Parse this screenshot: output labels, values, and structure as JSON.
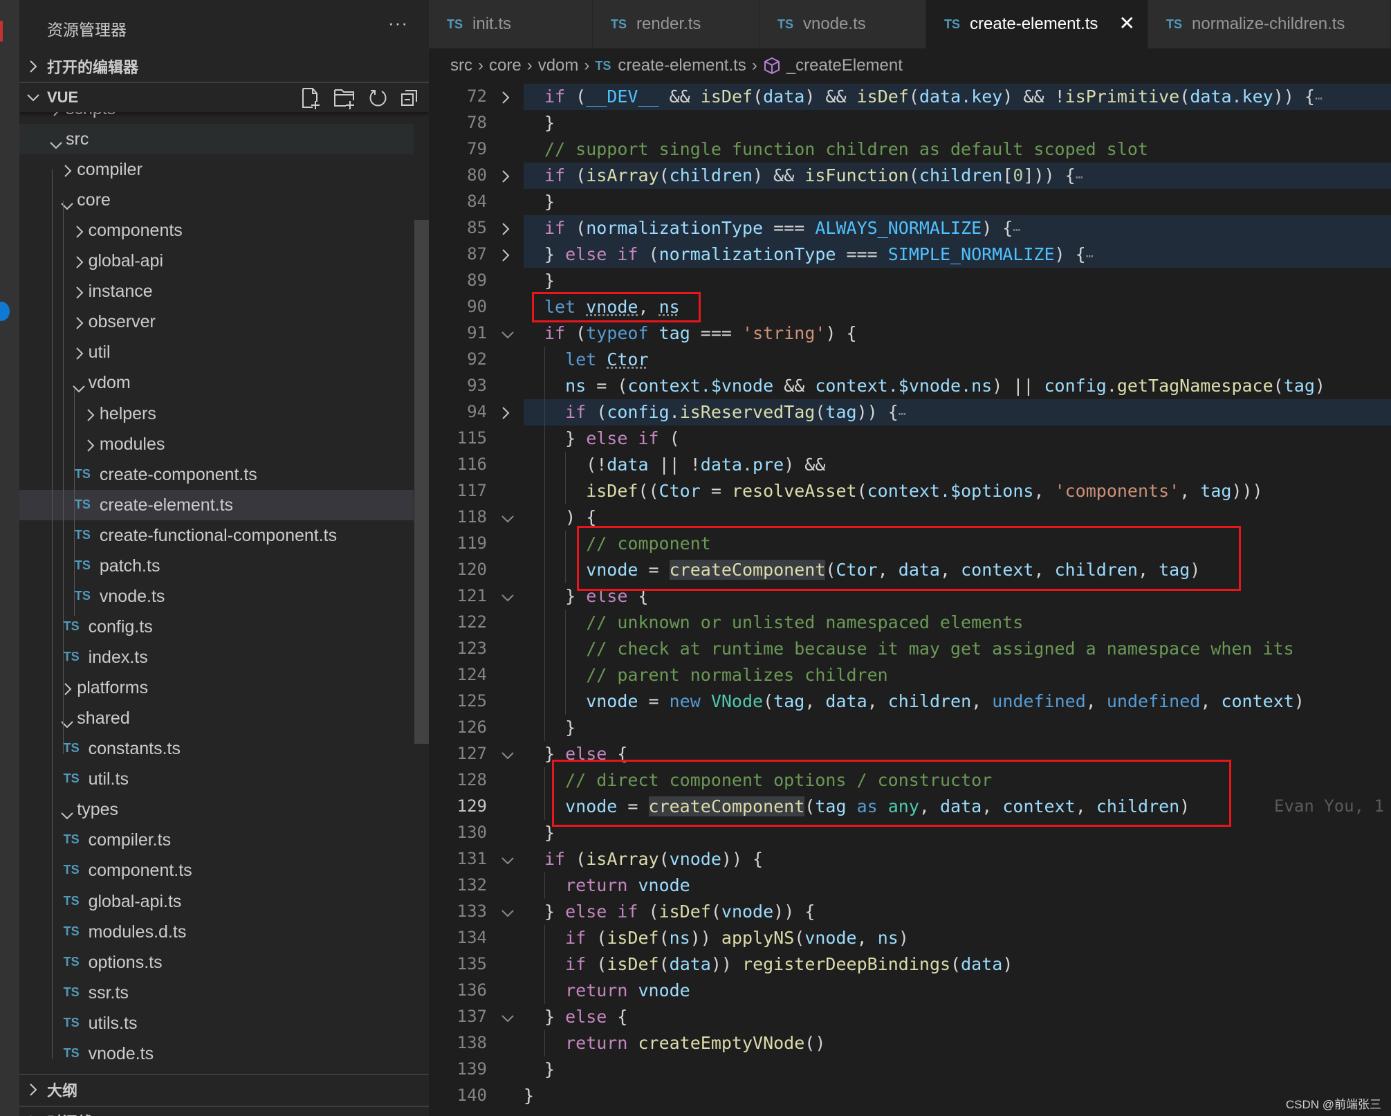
{
  "sidebar": {
    "title": "资源管理器",
    "more": "···",
    "open_editors": "打开的编辑器",
    "workspace": "VUE",
    "outline": "大纲",
    "timeline": "时间线",
    "actions": [
      "new-file-icon",
      "new-folder-icon",
      "refresh-icon",
      "collapse-all-icon"
    ],
    "tree": [
      {
        "label": "scripts",
        "level": 0,
        "type": "folder",
        "open": false
      },
      {
        "label": "src",
        "level": 0,
        "type": "folder",
        "open": true,
        "state": "hover"
      },
      {
        "label": "compiler",
        "level": 1,
        "type": "folder",
        "open": false
      },
      {
        "label": "core",
        "level": 1,
        "type": "folder",
        "open": true
      },
      {
        "label": "components",
        "level": 2,
        "type": "folder",
        "open": false
      },
      {
        "label": "global-api",
        "level": 2,
        "type": "folder",
        "open": false
      },
      {
        "label": "instance",
        "level": 2,
        "type": "folder",
        "open": false
      },
      {
        "label": "observer",
        "level": 2,
        "type": "folder",
        "open": false
      },
      {
        "label": "util",
        "level": 2,
        "type": "folder",
        "open": false
      },
      {
        "label": "vdom",
        "level": 2,
        "type": "folder",
        "open": true
      },
      {
        "label": "helpers",
        "level": 3,
        "type": "folder",
        "open": false
      },
      {
        "label": "modules",
        "level": 3,
        "type": "folder",
        "open": false
      },
      {
        "label": "create-component.ts",
        "level": 3,
        "type": "ts"
      },
      {
        "label": "create-element.ts",
        "level": 3,
        "type": "ts",
        "state": "selected"
      },
      {
        "label": "create-functional-component.ts",
        "level": 3,
        "type": "ts"
      },
      {
        "label": "patch.ts",
        "level": 3,
        "type": "ts"
      },
      {
        "label": "vnode.ts",
        "level": 3,
        "type": "ts"
      },
      {
        "label": "config.ts",
        "level": 2,
        "type": "ts"
      },
      {
        "label": "index.ts",
        "level": 2,
        "type": "ts"
      },
      {
        "label": "platforms",
        "level": 1,
        "type": "folder",
        "open": false
      },
      {
        "label": "shared",
        "level": 1,
        "type": "folder",
        "open": true
      },
      {
        "label": "constants.ts",
        "level": 2,
        "type": "ts"
      },
      {
        "label": "util.ts",
        "level": 2,
        "type": "ts"
      },
      {
        "label": "types",
        "level": 1,
        "type": "folder",
        "open": true
      },
      {
        "label": "compiler.ts",
        "level": 2,
        "type": "ts"
      },
      {
        "label": "component.ts",
        "level": 2,
        "type": "ts"
      },
      {
        "label": "global-api.ts",
        "level": 2,
        "type": "ts"
      },
      {
        "label": "modules.d.ts",
        "level": 2,
        "type": "ts"
      },
      {
        "label": "options.ts",
        "level": 2,
        "type": "ts"
      },
      {
        "label": "ssr.ts",
        "level": 2,
        "type": "ts"
      },
      {
        "label": "utils.ts",
        "level": 2,
        "type": "ts"
      },
      {
        "label": "vnode.ts",
        "level": 2,
        "type": "ts"
      }
    ]
  },
  "ts_badge": "TS",
  "tabs": [
    {
      "label": "init.ts",
      "active": false
    },
    {
      "label": "render.ts",
      "active": false
    },
    {
      "label": "vnode.ts",
      "active": false
    },
    {
      "label": "create-element.ts",
      "active": true
    },
    {
      "label": "normalize-children.ts",
      "active": false
    }
  ],
  "tab_close": "✕",
  "breadcrumb": {
    "parts": [
      "src",
      "core",
      "vdom"
    ],
    "file": "create-element.ts",
    "symbol": "_createElement",
    "separator": "›"
  },
  "blame": "Evan You, 1",
  "watermark": "CSDN @前端张三",
  "colors": {
    "accent": "#519aba",
    "highlight_box": "#e8161c",
    "background": "#1e1e1e",
    "sidebar": "#252526"
  },
  "code": [
    {
      "n": "72",
      "fold": "closed",
      "hl": true,
      "indent": 0,
      "tokens": [
        [
          "if",
          "k"
        ],
        [
          " (",
          "p"
        ],
        [
          "__DEV__",
          "C"
        ],
        [
          " && ",
          "p"
        ],
        [
          "isDef",
          "f"
        ],
        [
          "(",
          "p"
        ],
        [
          "data",
          "v"
        ],
        [
          ") && ",
          "p"
        ],
        [
          "isDef",
          "f"
        ],
        [
          "(",
          "p"
        ],
        [
          "data.key",
          "v"
        ],
        [
          ") && !",
          "p"
        ],
        [
          "isPrimitive",
          "f"
        ],
        [
          "(",
          "p"
        ],
        [
          "data.key",
          "v"
        ],
        [
          ")) {",
          "p"
        ],
        [
          "⋯",
          "e"
        ]
      ]
    },
    {
      "n": "78",
      "indent": 0,
      "tokens": [
        [
          "}",
          "p"
        ]
      ]
    },
    {
      "n": "79",
      "indent": 0,
      "tokens": [
        [
          "// support single function children as default scoped slot",
          "c"
        ]
      ]
    },
    {
      "n": "80",
      "fold": "closed",
      "hl": true,
      "indent": 0,
      "tokens": [
        [
          "if",
          "k"
        ],
        [
          " (",
          "p"
        ],
        [
          "isArray",
          "f"
        ],
        [
          "(",
          "p"
        ],
        [
          "children",
          "v"
        ],
        [
          ") && ",
          "p"
        ],
        [
          "isFunction",
          "f"
        ],
        [
          "(",
          "p"
        ],
        [
          "children",
          "v"
        ],
        [
          "[",
          "p"
        ],
        [
          "0",
          "n"
        ],
        [
          "])) {",
          "p"
        ],
        [
          "⋯",
          "e"
        ]
      ]
    },
    {
      "n": "84",
      "indent": 0,
      "tokens": [
        [
          "}",
          "p"
        ]
      ]
    },
    {
      "n": "85",
      "fold": "closed",
      "hl": true,
      "indent": 0,
      "tokens": [
        [
          "if",
          "k"
        ],
        [
          " (",
          "p"
        ],
        [
          "normalizationType",
          "v"
        ],
        [
          " === ",
          "p"
        ],
        [
          "ALWAYS_NORMALIZE",
          "C"
        ],
        [
          ") {",
          "p"
        ],
        [
          "⋯",
          "e"
        ]
      ]
    },
    {
      "n": "87",
      "fold": "closed",
      "hl": true,
      "indent": 0,
      "tokens": [
        [
          "} ",
          "p"
        ],
        [
          "else if",
          "k"
        ],
        [
          " (",
          "p"
        ],
        [
          "normalizationType",
          "v"
        ],
        [
          " === ",
          "p"
        ],
        [
          "SIMPLE_NORMALIZE",
          "C"
        ],
        [
          ") {",
          "p"
        ],
        [
          "⋯",
          "e"
        ]
      ]
    },
    {
      "n": "89",
      "indent": 0,
      "tokens": [
        [
          "}",
          "p"
        ]
      ]
    },
    {
      "n": "90",
      "indent": 0,
      "tokens": [
        [
          "let",
          "b"
        ],
        [
          " ",
          "p"
        ],
        [
          "vnode",
          "v dots"
        ],
        [
          ", ",
          "p"
        ],
        [
          "ns",
          "v dots"
        ]
      ]
    },
    {
      "n": "91",
      "fold": "open",
      "indent": 0,
      "tokens": [
        [
          "if",
          "k"
        ],
        [
          " (",
          "p"
        ],
        [
          "typeof",
          "b"
        ],
        [
          " ",
          "p"
        ],
        [
          "tag",
          "v"
        ],
        [
          " === ",
          "p"
        ],
        [
          "'string'",
          "s"
        ],
        [
          ") {",
          "p"
        ]
      ]
    },
    {
      "n": "92",
      "indent": 1,
      "tokens": [
        [
          "let",
          "b"
        ],
        [
          " ",
          "p"
        ],
        [
          "Ctor",
          "v dots"
        ]
      ]
    },
    {
      "n": "93",
      "indent": 1,
      "tokens": [
        [
          "ns",
          "v"
        ],
        [
          " = (",
          "p"
        ],
        [
          "context.$vnode",
          "v"
        ],
        [
          " && ",
          "p"
        ],
        [
          "context.$vnode.ns",
          "v"
        ],
        [
          ") || ",
          "p"
        ],
        [
          "config",
          "v"
        ],
        [
          ".",
          "p"
        ],
        [
          "getTagNamespace",
          "f"
        ],
        [
          "(",
          "p"
        ],
        [
          "tag",
          "v"
        ],
        [
          ")",
          "p"
        ]
      ]
    },
    {
      "n": "94",
      "fold": "closed",
      "hl": true,
      "indent": 1,
      "tokens": [
        [
          "if",
          "k"
        ],
        [
          " (",
          "p"
        ],
        [
          "config",
          "v"
        ],
        [
          ".",
          "p"
        ],
        [
          "isReservedTag",
          "f"
        ],
        [
          "(",
          "p"
        ],
        [
          "tag",
          "v"
        ],
        [
          ")) {",
          "p"
        ],
        [
          "⋯",
          "e"
        ]
      ]
    },
    {
      "n": "115",
      "indent": 1,
      "tokens": [
        [
          "} ",
          "p"
        ],
        [
          "else if",
          "k"
        ],
        [
          " (",
          "p"
        ]
      ]
    },
    {
      "n": "116",
      "indent": 2,
      "tokens": [
        [
          "(!",
          "p"
        ],
        [
          "data",
          "v"
        ],
        [
          " || !",
          "p"
        ],
        [
          "data.pre",
          "v"
        ],
        [
          ") &&",
          "p"
        ]
      ]
    },
    {
      "n": "117",
      "indent": 2,
      "tokens": [
        [
          "isDef",
          "f"
        ],
        [
          "((",
          "p"
        ],
        [
          "Ctor",
          "v"
        ],
        [
          " = ",
          "p"
        ],
        [
          "resolveAsset",
          "f"
        ],
        [
          "(",
          "p"
        ],
        [
          "context.$options",
          "v"
        ],
        [
          ", ",
          "p"
        ],
        [
          "'components'",
          "s"
        ],
        [
          ", ",
          "p"
        ],
        [
          "tag",
          "v"
        ],
        [
          ")))",
          "p"
        ]
      ]
    },
    {
      "n": "118",
      "fold": "open",
      "indent": 1,
      "tokens": [
        [
          ") {",
          "p"
        ]
      ]
    },
    {
      "n": "119",
      "indent": 2,
      "tokens": [
        [
          "// component",
          "c"
        ]
      ]
    },
    {
      "n": "120",
      "indent": 2,
      "tokens": [
        [
          "vnode",
          "v"
        ],
        [
          " = ",
          "p"
        ],
        [
          "createComponent",
          "f w"
        ],
        [
          "(",
          "p"
        ],
        [
          "Ctor",
          "v"
        ],
        [
          ", ",
          "p"
        ],
        [
          "data",
          "v"
        ],
        [
          ", ",
          "p"
        ],
        [
          "context",
          "v"
        ],
        [
          ", ",
          "p"
        ],
        [
          "children",
          "v"
        ],
        [
          ", ",
          "p"
        ],
        [
          "tag",
          "v"
        ],
        [
          ")",
          "p"
        ]
      ]
    },
    {
      "n": "121",
      "fold": "open",
      "indent": 1,
      "tokens": [
        [
          "} ",
          "p"
        ],
        [
          "else",
          "k"
        ],
        [
          " {",
          "p"
        ]
      ]
    },
    {
      "n": "122",
      "indent": 2,
      "tokens": [
        [
          "// unknown or unlisted namespaced elements",
          "c"
        ]
      ]
    },
    {
      "n": "123",
      "indent": 2,
      "tokens": [
        [
          "// check at runtime because it may get assigned a namespace when its",
          "c"
        ]
      ]
    },
    {
      "n": "124",
      "indent": 2,
      "tokens": [
        [
          "// parent normalizes children",
          "c"
        ]
      ]
    },
    {
      "n": "125",
      "indent": 2,
      "tokens": [
        [
          "vnode",
          "v"
        ],
        [
          " = ",
          "p"
        ],
        [
          "new",
          "b"
        ],
        [
          " ",
          "p"
        ],
        [
          "VNode",
          "t"
        ],
        [
          "(",
          "p"
        ],
        [
          "tag",
          "v"
        ],
        [
          ", ",
          "p"
        ],
        [
          "data",
          "v"
        ],
        [
          ", ",
          "p"
        ],
        [
          "children",
          "v"
        ],
        [
          ", ",
          "p"
        ],
        [
          "undefined",
          "b"
        ],
        [
          ", ",
          "p"
        ],
        [
          "undefined",
          "b"
        ],
        [
          ", ",
          "p"
        ],
        [
          "context",
          "v"
        ],
        [
          ")",
          "p"
        ]
      ]
    },
    {
      "n": "126",
      "indent": 1,
      "tokens": [
        [
          "}",
          "p"
        ]
      ]
    },
    {
      "n": "127",
      "fold": "open",
      "indent": 0,
      "tokens": [
        [
          "} ",
          "p"
        ],
        [
          "else",
          "k"
        ],
        [
          " {",
          "p"
        ]
      ]
    },
    {
      "n": "128",
      "indent": 1,
      "tokens": [
        [
          "// direct component options / constructor",
          "c"
        ]
      ]
    },
    {
      "n": "129",
      "indent": 1,
      "current": true,
      "blame": true,
      "tokens": [
        [
          "vnode",
          "v"
        ],
        [
          " = ",
          "p"
        ],
        [
          "createComponent",
          "f w"
        ],
        [
          "(",
          "p"
        ],
        [
          "tag",
          "v"
        ],
        [
          " ",
          "p"
        ],
        [
          "as",
          "b"
        ],
        [
          " ",
          "p"
        ],
        [
          "any",
          "t"
        ],
        [
          ", ",
          "p"
        ],
        [
          "data",
          "v"
        ],
        [
          ", ",
          "p"
        ],
        [
          "context",
          "v"
        ],
        [
          ", ",
          "p"
        ],
        [
          "children",
          "v"
        ],
        [
          ")",
          "p"
        ]
      ]
    },
    {
      "n": "130",
      "indent": 0,
      "tokens": [
        [
          "}",
          "p"
        ]
      ]
    },
    {
      "n": "131",
      "fold": "open",
      "indent": 0,
      "tokens": [
        [
          "if",
          "k"
        ],
        [
          " (",
          "p"
        ],
        [
          "isArray",
          "f"
        ],
        [
          "(",
          "p"
        ],
        [
          "vnode",
          "v"
        ],
        [
          ")) {",
          "p"
        ]
      ]
    },
    {
      "n": "132",
      "indent": 1,
      "tokens": [
        [
          "return",
          "k"
        ],
        [
          " ",
          "p"
        ],
        [
          "vnode",
          "v"
        ]
      ]
    },
    {
      "n": "133",
      "fold": "open",
      "indent": 0,
      "tokens": [
        [
          "} ",
          "p"
        ],
        [
          "else if",
          "k"
        ],
        [
          " (",
          "p"
        ],
        [
          "isDef",
          "f"
        ],
        [
          "(",
          "p"
        ],
        [
          "vnode",
          "v"
        ],
        [
          ")) {",
          "p"
        ]
      ]
    },
    {
      "n": "134",
      "indent": 1,
      "tokens": [
        [
          "if",
          "k"
        ],
        [
          " (",
          "p"
        ],
        [
          "isDef",
          "f"
        ],
        [
          "(",
          "p"
        ],
        [
          "ns",
          "v"
        ],
        [
          ")) ",
          "p"
        ],
        [
          "applyNS",
          "f"
        ],
        [
          "(",
          "p"
        ],
        [
          "vnode",
          "v"
        ],
        [
          ", ",
          "p"
        ],
        [
          "ns",
          "v"
        ],
        [
          ")",
          "p"
        ]
      ]
    },
    {
      "n": "135",
      "indent": 1,
      "tokens": [
        [
          "if",
          "k"
        ],
        [
          " (",
          "p"
        ],
        [
          "isDef",
          "f"
        ],
        [
          "(",
          "p"
        ],
        [
          "data",
          "v"
        ],
        [
          ")) ",
          "p"
        ],
        [
          "registerDeepBindings",
          "f"
        ],
        [
          "(",
          "p"
        ],
        [
          "data",
          "v"
        ],
        [
          ")",
          "p"
        ]
      ]
    },
    {
      "n": "136",
      "indent": 1,
      "tokens": [
        [
          "return",
          "k"
        ],
        [
          " ",
          "p"
        ],
        [
          "vnode",
          "v"
        ]
      ]
    },
    {
      "n": "137",
      "fold": "open",
      "indent": 0,
      "tokens": [
        [
          "} ",
          "p"
        ],
        [
          "else",
          "k"
        ],
        [
          " {",
          "p"
        ]
      ]
    },
    {
      "n": "138",
      "indent": 1,
      "tokens": [
        [
          "return",
          "k"
        ],
        [
          " ",
          "p"
        ],
        [
          "createEmptyVNode",
          "f"
        ],
        [
          "()",
          "p"
        ]
      ]
    },
    {
      "n": "139",
      "indent": 0,
      "tokens": [
        [
          "}",
          "p"
        ]
      ]
    },
    {
      "n": "140",
      "indent": -1,
      "tokens": [
        [
          "}",
          "p"
        ]
      ]
    }
  ]
}
